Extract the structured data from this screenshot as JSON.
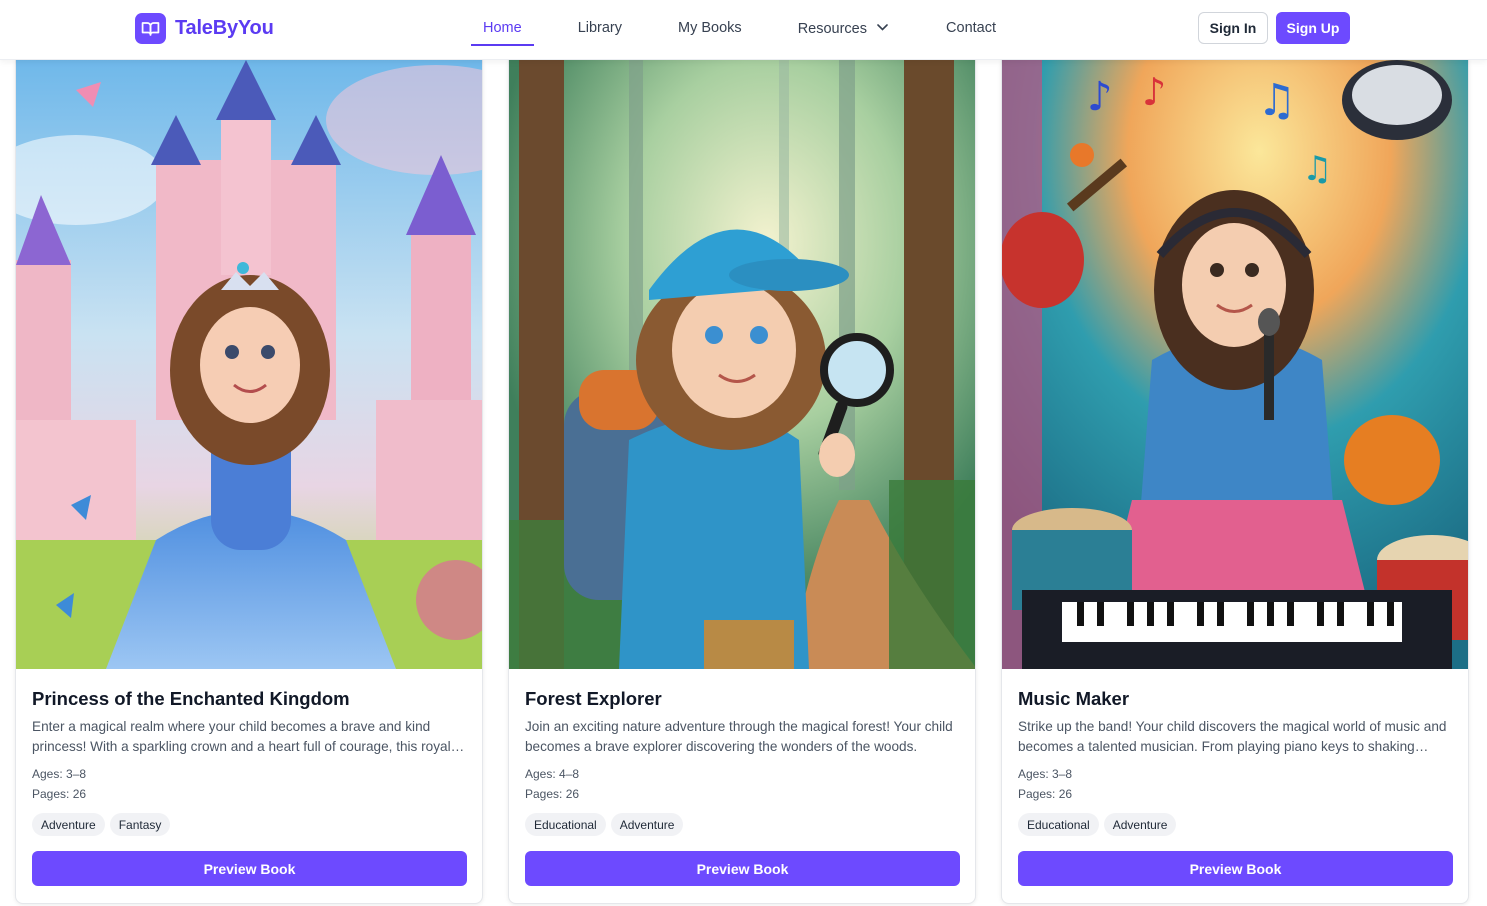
{
  "brand": {
    "name": "TaleByYou",
    "icon": "book-open-icon",
    "accent": "#6d4aff"
  },
  "nav": {
    "home": "Home",
    "library": "Library",
    "my_books": "My Books",
    "resources": "Resources",
    "contact": "Contact"
  },
  "auth": {
    "sign_in": "Sign In",
    "sign_up": "Sign Up"
  },
  "books": [
    {
      "title": "Princess of the Enchanted Kingdom",
      "description": "Enter a magical realm where your child becomes a brave and kind princess! With a sparkling crown and a heart full of courage, this royal adventure awaits.",
      "ages": "Ages: 3–8",
      "pages": "Pages: 26",
      "tags": [
        "Adventure",
        "Fantasy"
      ],
      "button": "Preview Book"
    },
    {
      "title": "Forest Explorer",
      "description": "Join an exciting nature adventure through the magical forest! Your child becomes a brave explorer discovering the wonders of the woods.",
      "ages": "Ages: 4–8",
      "pages": "Pages: 26",
      "tags": [
        "Educational",
        "Adventure"
      ],
      "button": "Preview Book"
    },
    {
      "title": "Music Maker",
      "description": "Strike up the band! Your child discovers the magical world of music and becomes a talented musician. From playing piano keys to shaking maracas.",
      "ages": "Ages: 3–8",
      "pages": "Pages: 26",
      "tags": [
        "Educational",
        "Adventure"
      ],
      "button": "Preview Book"
    }
  ]
}
